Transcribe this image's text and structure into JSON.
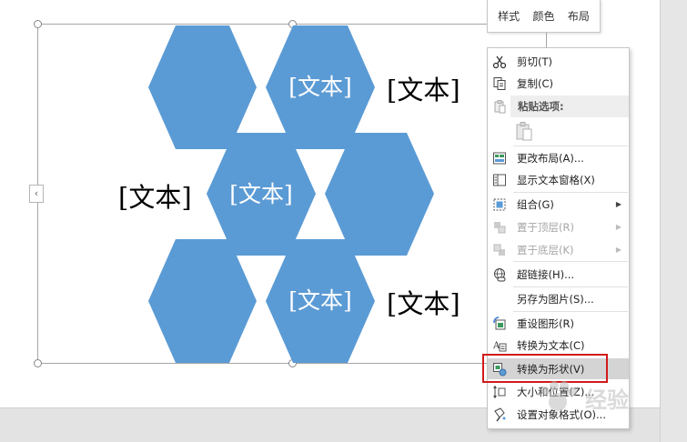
{
  "mini_toolbar": {
    "style": "样式",
    "color": "颜色",
    "layout": "布局"
  },
  "smartart": {
    "hex_labels": [
      "[文本]",
      "[文本]",
      "[文本]"
    ],
    "side_labels": [
      "[文本]",
      "[文本]",
      "[文本]"
    ],
    "hex_fill": "#5b9bd5"
  },
  "context_menu": {
    "cut": "剪切(T)",
    "copy": "复制(C)",
    "paste_options": "粘贴选项:",
    "change_layout": "更改布局(A)...",
    "text_pane": "显示文本窗格(X)",
    "group": "组合(G)",
    "bring_front": "置于顶层(R)",
    "send_back": "置于底层(K)",
    "hyperlink": "超链接(H)...",
    "save_picture": "另存为图片(S)...",
    "reset_graphic": "重设图形(R)",
    "convert_text": "转换为文本(C)",
    "convert_shapes": "转换为形状(V)",
    "size_position": "大小和位置(Z)...",
    "format_object": "设置对象格式(O)..."
  },
  "highlight_color": "#d11a1a",
  "watermark_text": "经验"
}
